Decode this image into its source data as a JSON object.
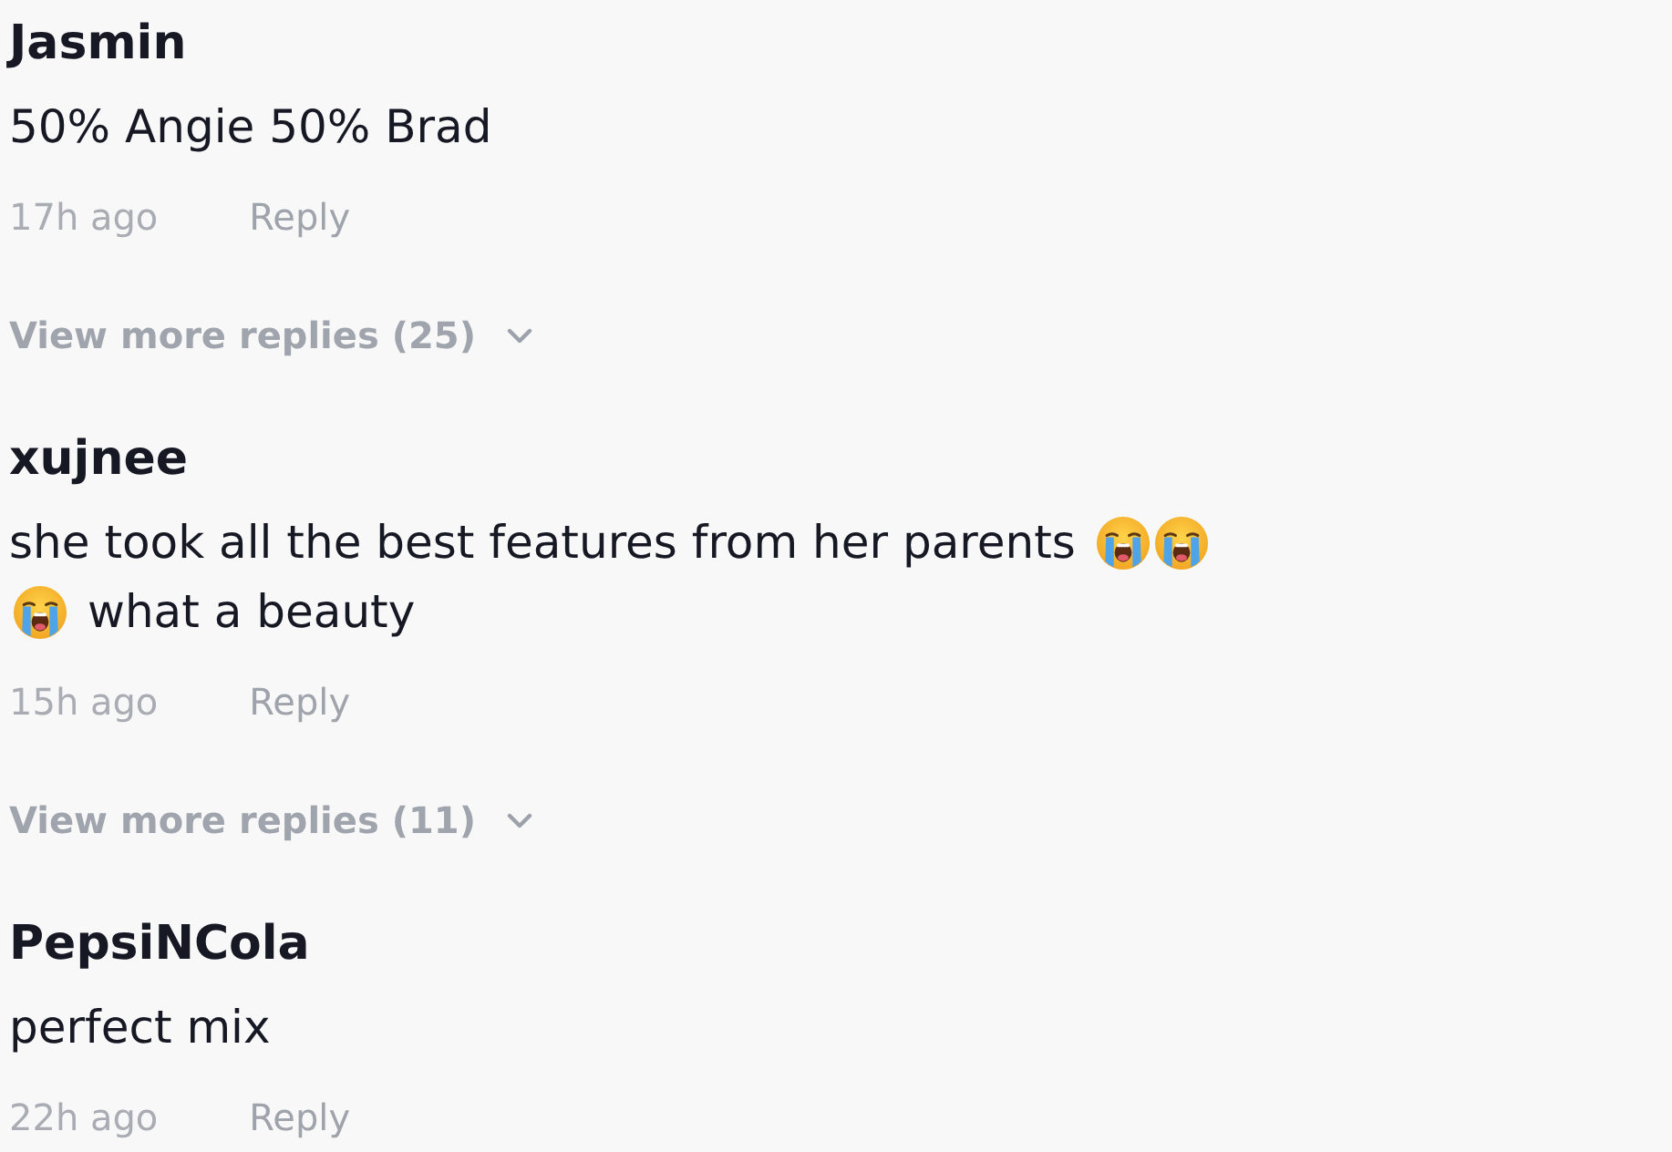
{
  "comments": [
    {
      "author": "Jasmin",
      "body": [
        {
          "kind": "text",
          "text": "50% Angie 50% Brad"
        }
      ],
      "time": "17h ago",
      "reply_label": "Reply",
      "more_replies": "View more replies (25)"
    },
    {
      "author": "xujnee",
      "body": [
        {
          "kind": "text",
          "text": "she took all the best features from her parents"
        },
        {
          "kind": "emoji"
        },
        {
          "kind": "emoji"
        },
        {
          "kind": "emoji"
        },
        {
          "kind": "text",
          "text": "what a beauty"
        }
      ],
      "time": "15h ago",
      "reply_label": "Reply",
      "more_replies": "View more replies (11)"
    },
    {
      "author": "PepsiNCola",
      "body": [
        {
          "kind": "text",
          "text": "perfect mix"
        }
      ],
      "time": "22h ago",
      "reply_label": "Reply"
    }
  ]
}
